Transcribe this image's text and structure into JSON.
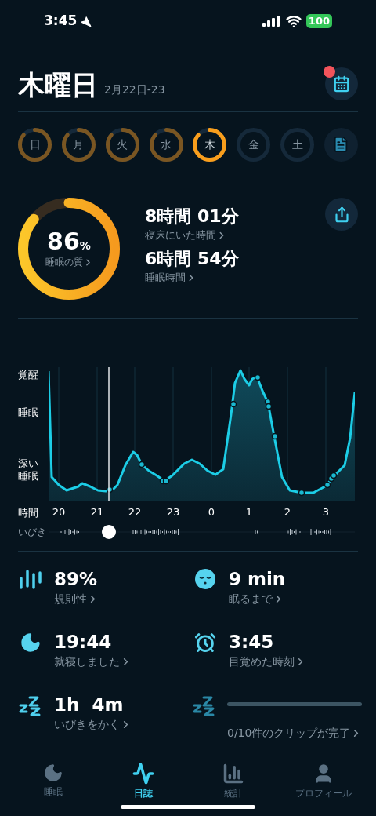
{
  "status_bar": {
    "time": "3:45",
    "battery": "100"
  },
  "header": {
    "title": "木曜日",
    "date_range": "2月22日-23",
    "calendar_badge": true
  },
  "days": [
    {
      "label": "日",
      "selected": false,
      "recorded": true
    },
    {
      "label": "月",
      "selected": false,
      "recorded": true
    },
    {
      "label": "火",
      "selected": false,
      "recorded": true
    },
    {
      "label": "水",
      "selected": false,
      "recorded": true
    },
    {
      "label": "木",
      "selected": true,
      "recorded": true
    },
    {
      "label": "金",
      "selected": false,
      "recorded": false
    },
    {
      "label": "土",
      "selected": false,
      "recorded": false
    }
  ],
  "summary": {
    "score": "86",
    "unit": "%",
    "score_label": "睡眠の質",
    "level": 0.86,
    "metrics": [
      {
        "value": "8時間 01分",
        "label": "寝床にいた時間"
      },
      {
        "value": "6時間 54分",
        "label": "睡眠時間"
      }
    ]
  },
  "graph": {
    "stage_labels": [
      "覚醒",
      "睡眠",
      "深い睡眠"
    ],
    "time_label": "時間",
    "hours": [
      "20",
      "21",
      "22",
      "23",
      "0",
      "1",
      "2",
      "3"
    ],
    "snore_label": "いびき"
  },
  "stats": [
    {
      "kind": "value",
      "value": "89%",
      "label": "規則性"
    },
    {
      "kind": "value",
      "value": "9 min",
      "label": "眠るまで"
    },
    {
      "kind": "value",
      "value": "19:44",
      "label": "就寝しました"
    },
    {
      "kind": "value",
      "value": "3:45",
      "label": "目覚めた時刻"
    },
    {
      "kind": "value",
      "value": "1h  4m",
      "label": "いびきをかく"
    },
    {
      "kind": "progress",
      "label": "0/10件のクリップが完了"
    }
  ],
  "tabs": [
    {
      "label": "睡眠",
      "selected": false
    },
    {
      "label": "日誌",
      "selected": true
    },
    {
      "label": "統計",
      "selected": false
    },
    {
      "label": "プロフィール",
      "selected": false
    }
  ]
}
